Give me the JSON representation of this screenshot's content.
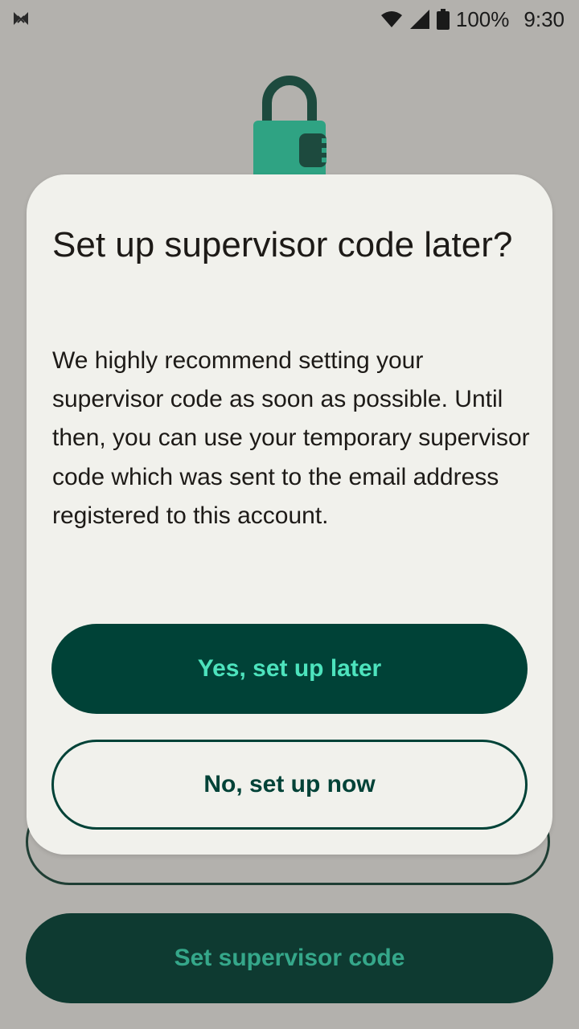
{
  "status_bar": {
    "battery_percent": "100%",
    "time": "9:30"
  },
  "background": {
    "outline_button_label": "",
    "primary_button_label": "Set supervisor code"
  },
  "dialog": {
    "title": "Set up supervisor code later?",
    "body": "We highly recommend setting your supervisor code as soon as possible. Until then, you can use your temporary supervisor code which was sent to the email address registered to this account.",
    "confirm_label": "Yes, set up later",
    "cancel_label": "No, set up now"
  },
  "colors": {
    "scrim_background": "#b3b1ad",
    "dialog_surface": "#f1f1ec",
    "primary_dark": "#004237",
    "primary_accent": "#4de3bd",
    "lock_green": "#2fa383"
  },
  "icons": {
    "status_left": "app-notification-icon",
    "wifi": "wifi-icon",
    "signal": "cell-signal-icon",
    "battery": "battery-icon",
    "lock": "padlock-icon"
  }
}
